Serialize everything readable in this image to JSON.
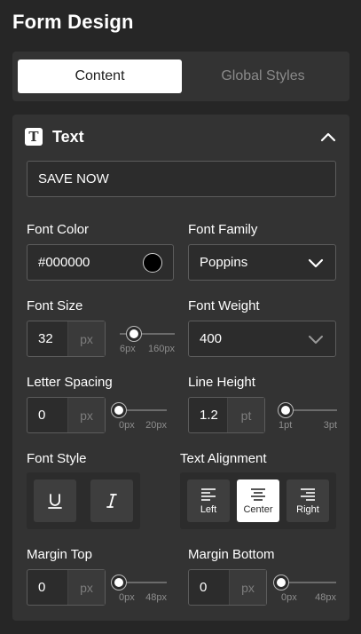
{
  "page_title": "Form Design",
  "tabs": [
    {
      "label": "Content",
      "active": true
    },
    {
      "label": "Global Styles",
      "active": false
    }
  ],
  "section": {
    "title": "Text",
    "icon": "text-type-icon"
  },
  "text_value": "SAVE NOW",
  "font_color": {
    "label": "Font Color",
    "value": "#000000",
    "swatch": "#000000"
  },
  "font_family": {
    "label": "Font Family",
    "value": "Poppins"
  },
  "font_size": {
    "label": "Font Size",
    "value": "32",
    "unit": "px",
    "min": "6px",
    "max": "160px",
    "level": 0.17
  },
  "font_weight": {
    "label": "Font Weight",
    "value": "400"
  },
  "letter_spacing": {
    "label": "Letter Spacing",
    "value": "0",
    "unit": "px",
    "min": "0px",
    "max": "20px",
    "level": 0
  },
  "line_height": {
    "label": "Line Height",
    "value": "1.2",
    "unit": "pt",
    "min": "1pt",
    "max": "3pt",
    "level": 0
  },
  "font_style": {
    "label": "Font Style",
    "buttons": [
      "underline-icon",
      "italic-icon"
    ]
  },
  "text_alignment": {
    "label": "Text Alignment",
    "options": [
      {
        "label": "Left",
        "active": false
      },
      {
        "label": "Center",
        "active": true
      },
      {
        "label": "Right",
        "active": false
      }
    ]
  },
  "margin_top": {
    "label": "Margin Top",
    "value": "0",
    "unit": "px",
    "min": "0px",
    "max": "48px",
    "level": 0
  },
  "margin_bottom": {
    "label": "Margin Bottom",
    "value": "0",
    "unit": "px",
    "min": "0px",
    "max": "48px",
    "level": 0
  }
}
